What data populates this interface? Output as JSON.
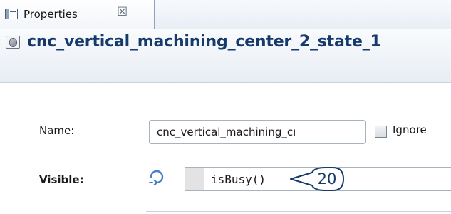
{
  "tab": {
    "icon": "properties-view-icon",
    "label": "Properties",
    "close_glyph": "☒"
  },
  "header": {
    "icon": "object-state-icon",
    "title": "cnc_vertical_machining_center_2_state_1"
  },
  "form": {
    "name_label": "Name:",
    "name_value": "cnc_vertical_machining_cı",
    "ignore_label": "Ignore",
    "ignore_checked": false,
    "visible_label": "Visible:",
    "visible_icon": "dynamic-value-icon",
    "visible_value": "isBusy()"
  },
  "annotation": {
    "callout_number": "20"
  },
  "colors": {
    "title": "#163a6b",
    "callout": "#163a6b",
    "border": "#a9b3c0"
  }
}
